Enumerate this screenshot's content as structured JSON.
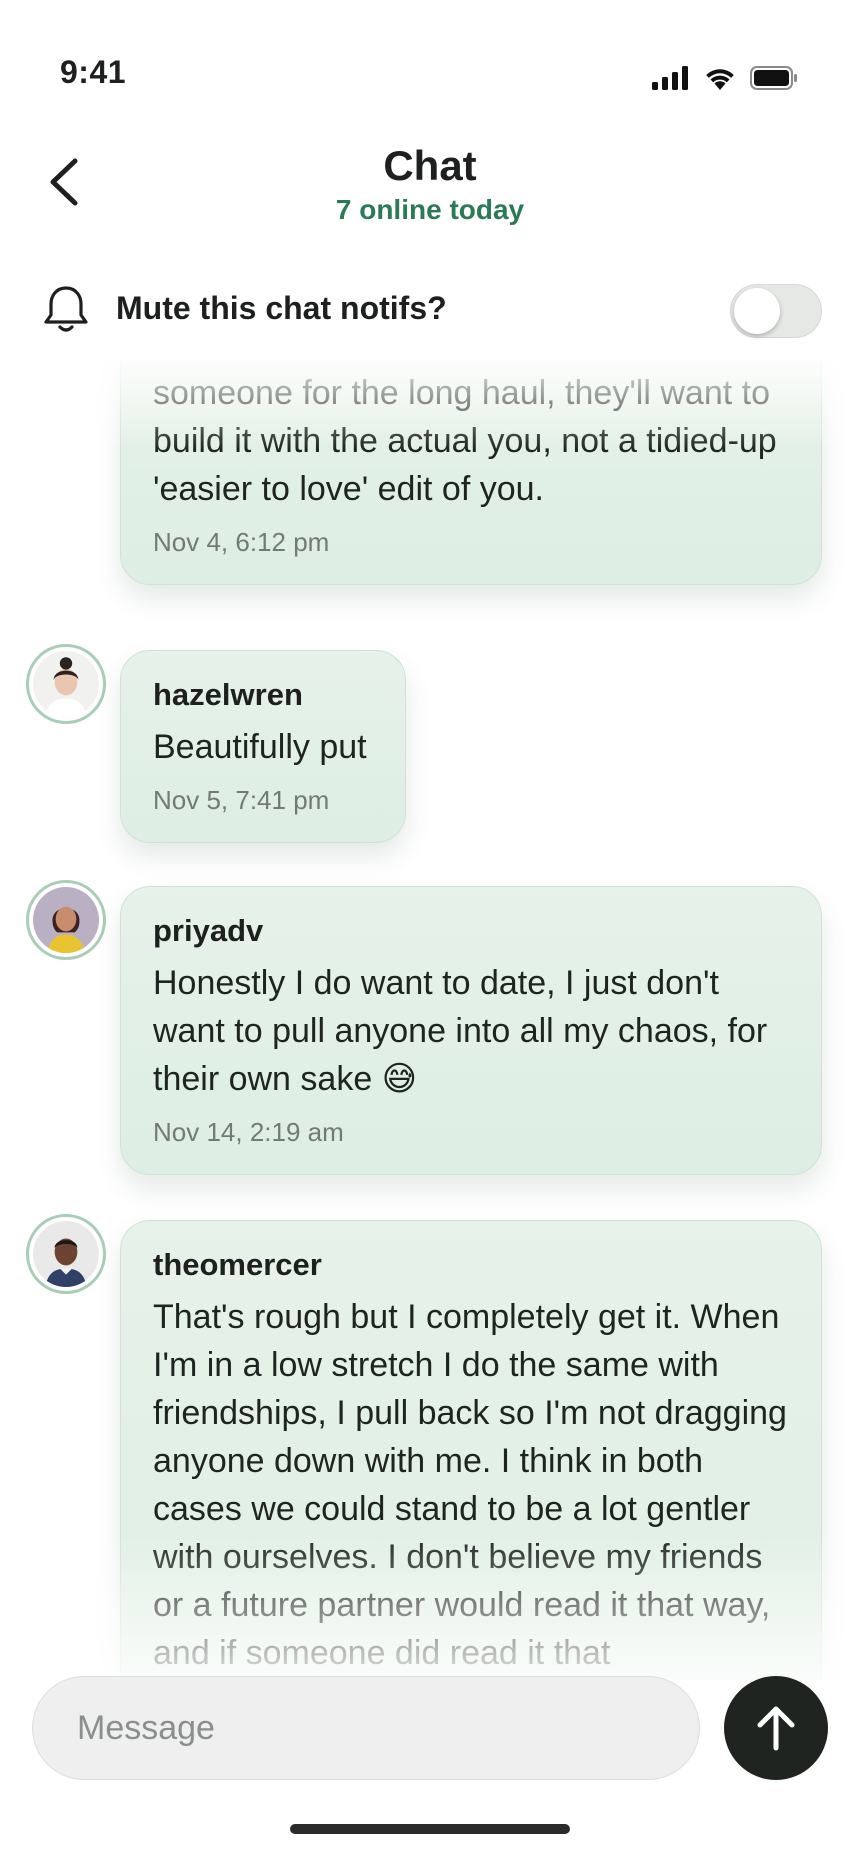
{
  "status_bar": {
    "time": "9:41",
    "icons": [
      "cellular-signal-icon",
      "wifi-icon",
      "battery-icon"
    ]
  },
  "header": {
    "back_icon": "chevron-left-icon",
    "title": "Chat",
    "subtitle": "7 online today"
  },
  "mute": {
    "icon": "bell-icon",
    "label": "Mute this chat notifs?",
    "enabled": false
  },
  "messages": [
    {
      "author": "",
      "text": "someone for the long haul, they'll want to build it with the actual you, not a tidied-up 'easier to love' edit of you.",
      "time": "Nov 4, 6:12 pm"
    },
    {
      "author": "hazelwren",
      "text": "Beautifully put",
      "time": "Nov 5, 7:41 pm"
    },
    {
      "author": "priyadv",
      "text": "Honestly I do want to date, I just don't want to pull anyone into all my chaos, for their own sake 😅",
      "time": "Nov 14, 2:19 am"
    },
    {
      "author": "theomercer",
      "text": "That's rough but I completely get it. When I'm in a low stretch I do the same with friendships, I pull back so I'm not dragging anyone down with me. I think in both cases we could stand to be a lot gentler with ourselves. I don't believe my friends or a future partner would read it that way, and if someone did read it that",
      "time": ""
    }
  ],
  "composer": {
    "placeholder": "Message",
    "value": "",
    "send_icon": "arrow-up-icon"
  },
  "colors": {
    "accent": "#2b7a55",
    "bubble_bg": "#e3f0e6",
    "send_button": "#1f2421",
    "avatar_ring": "#a9cdb7"
  }
}
